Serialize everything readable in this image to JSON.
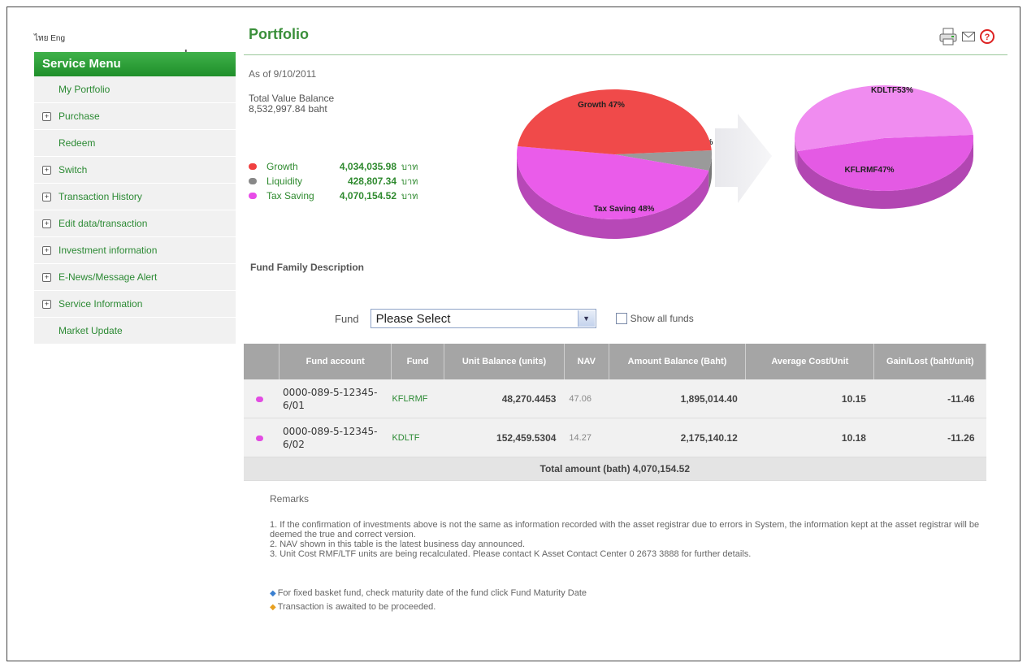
{
  "header": {
    "lang_label": "ไทย Eng",
    "title": "Portfolio"
  },
  "sidebar": {
    "heading": "Service Menu",
    "items": [
      {
        "label": "My Portfolio",
        "expandable": false
      },
      {
        "label": "Purchase",
        "expandable": true
      },
      {
        "label": "Redeem",
        "expandable": false
      },
      {
        "label": "Switch",
        "expandable": true
      },
      {
        "label": "Transaction History",
        "expandable": true
      },
      {
        "label": "Edit data/transaction",
        "expandable": true
      },
      {
        "label": "Investment information",
        "expandable": true
      },
      {
        "label": "E-News/Message Alert",
        "expandable": true
      },
      {
        "label": "Service Information",
        "expandable": true
      },
      {
        "label": "Market Update",
        "expandable": false
      }
    ]
  },
  "summary": {
    "as_of": "As of  9/10/2011",
    "total_label": "Total Value Balance",
    "total_value": "8,532,997.84 baht"
  },
  "legend": [
    {
      "name": "Growth",
      "value": "4,034,035.98",
      "currency": "บาท",
      "color": "#f04040"
    },
    {
      "name": "Liquidity",
      "value": "428,807.34",
      "currency": "บาท",
      "color": "#888888"
    },
    {
      "name": "Tax Saving",
      "value": "4,070,154.52",
      "currency": "บาท",
      "color": "#e84ce8"
    }
  ],
  "chart_data": [
    {
      "type": "pie",
      "slices": [
        {
          "label": "Growth 47%",
          "value": 47,
          "color": "#f04a4a"
        },
        {
          "label": "Liquidity 5%",
          "value": 5,
          "color": "#9a9a9a"
        },
        {
          "label": "Tax Saving 48%",
          "value": 48,
          "color": "#ea5cea"
        }
      ]
    },
    {
      "type": "pie",
      "slices": [
        {
          "label": "KDLTF53%",
          "value": 53,
          "color": "#f08cf0"
        },
        {
          "label": "KFLRMF47%",
          "value": 47,
          "color": "#e45ae4"
        }
      ]
    }
  ],
  "fund_section": {
    "heading": "Fund Family Description",
    "fund_label": "Fund",
    "select_value": "Please Select",
    "show_all_label": "Show all funds"
  },
  "table": {
    "headers": [
      "Fund account",
      "Fund",
      "Unit Balance (units)",
      "NAV",
      "Amount Balance (Baht)",
      "Average Cost/Unit",
      "Gain/Lost (baht/unit)"
    ],
    "rows": [
      {
        "account": "0000-089-5-12345-6/01",
        "fund": "KFLRMF",
        "units": "48,270.4453",
        "nav": "47.06",
        "amount": "1,895,014.40",
        "avg": "10.15",
        "gain": "-11.46"
      },
      {
        "account": "0000-089-5-12345-6/02",
        "fund": "KDLTF",
        "units": "152,459.5304",
        "nav": "14.27",
        "amount": "2,175,140.12",
        "avg": "10.18",
        "gain": "-11.26"
      }
    ],
    "total": "Total amount (bath)  4,070,154.52"
  },
  "remarks": {
    "heading": "Remarks",
    "notes": [
      "1. If the confirmation of investments above is not the same as information recorded with the asset registrar due to errors in System, the information kept at the asset registrar will be deemed the true and correct version.",
      "2. NAV shown in this table is the latest business day announced.",
      "3. Unit Cost RMF/LTF units are being recalculated. Please contact K Asset Contact Center 0 2673 3888 for further details."
    ],
    "tips": [
      {
        "text": "For fixed basket fund, check maturity date of the fund click Fund Maturity Date",
        "color": "#3a7fd0"
      },
      {
        "text": "Transaction is awaited to be proceeded.",
        "color": "#e8a020"
      }
    ]
  }
}
